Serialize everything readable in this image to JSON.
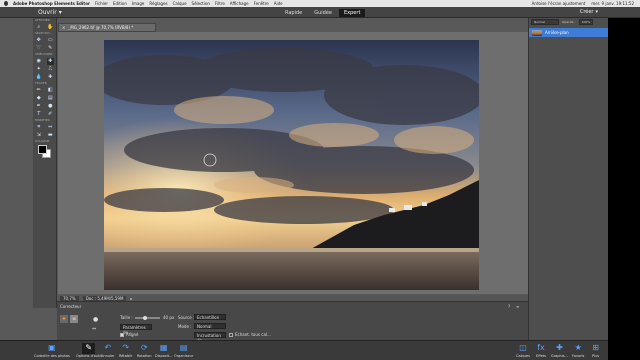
{
  "menubar": {
    "app": "Adobe Photoshop Elements Editor",
    "items": [
      "Fichier",
      "Edition",
      "Image",
      "Réglages",
      "Calque",
      "Sélection",
      "Filtre",
      "Affichage",
      "Fenêtre",
      "Aide"
    ],
    "status": "Ardoise l'écran ajustement",
    "clock": "mer. 9 janv.  19:11:52"
  },
  "appbar": {
    "open_label": "Ouvrir",
    "modes": [
      "Rapide",
      "Guidée",
      "Expert"
    ],
    "active_mode": "Expert",
    "create_label": "Créer"
  },
  "toolbox": {
    "section_view": "AFFICHER",
    "section_select": "SÉLECTIO...",
    "section_enhance": "AMÉLIORER",
    "section_draw": "TRACER",
    "section_modify": "MODIFIER",
    "section_color": "COULEUR"
  },
  "document": {
    "tab_title": "_MG_2962.tif @ 70,7% (RVB/8) *",
    "zoom": "70,7%",
    "doc_info": "Doc : 5,49M/5,59M"
  },
  "layers_panel": {
    "blend_mode": "Normal",
    "opacity_label": "Opacité :",
    "opacity_value": "100%",
    "layer_name": "Arrière-plan"
  },
  "options_bar": {
    "tool_name": "Correcteur",
    "size_label": "Taille :",
    "size_value": "40 px",
    "brush_settings": "Paramètres de...",
    "aligned_label": "Aligné",
    "source_label": "Source :",
    "source_value": "Echantillon",
    "mode_label": "Mode :",
    "mode_value": "Normal",
    "pattern_value": "Incrustation de...",
    "sample_all_label": "Echant. tous cal...",
    "size_fraction": 0.4
  },
  "bottombar": {
    "left": [
      {
        "icon": "photo-bin-icon",
        "label": "Corbeille des photos"
      },
      {
        "icon": "tool-options-icon",
        "label": "Options d'outil"
      },
      {
        "icon": "undo-icon",
        "label": "Annuler"
      },
      {
        "icon": "redo-icon",
        "label": "Rétablir"
      },
      {
        "icon": "rotate-icon",
        "label": "Rotation"
      },
      {
        "icon": "layout-icon",
        "label": "Disposit..."
      },
      {
        "icon": "organizer-icon",
        "label": "Organiseur"
      }
    ],
    "right": [
      {
        "icon": "layers-icon",
        "label": "Calques"
      },
      {
        "icon": "effects-icon",
        "label": "Effets"
      },
      {
        "icon": "graphics-icon",
        "label": "Graphis..."
      },
      {
        "icon": "favorites-icon",
        "label": "Favoris"
      },
      {
        "icon": "more-icon",
        "label": "Plus"
      }
    ]
  }
}
